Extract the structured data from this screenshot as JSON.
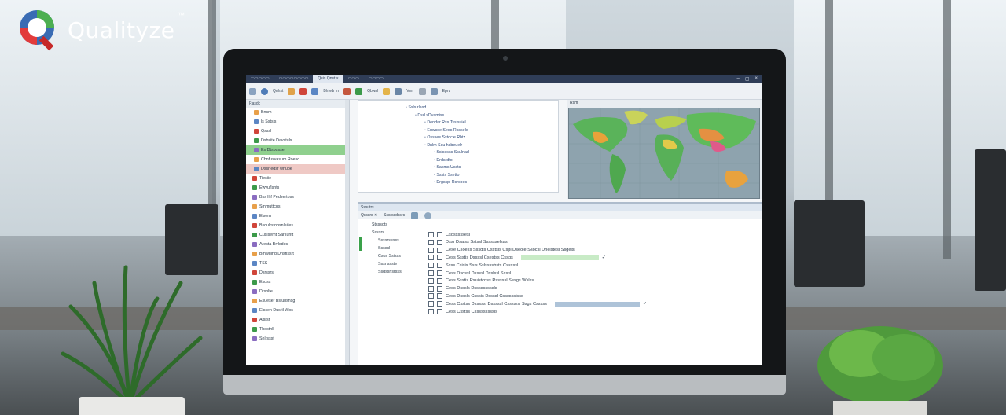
{
  "brand": {
    "name": "Qualityze",
    "tm": "™"
  },
  "window": {
    "tabs": [
      "▭▭▭▭▭",
      "▭▭▭▭▭▭▭▭",
      "Qsis Qnst  ×",
      "▭▭▭",
      "▭▭▭▭"
    ],
    "controls": [
      "–",
      "▢",
      "×"
    ]
  },
  "toolbar": {
    "labels": [
      "Qnhst",
      "Bhfvdr ln",
      "Qbwnl",
      "Vnrr",
      "Eprv"
    ]
  },
  "left_pane": {
    "header": "Rasdc",
    "rows": [
      {
        "label": "Bnsm",
        "icon": "folder-icon",
        "hl": ""
      },
      {
        "label": "ls Sstsls",
        "icon": "doc-icon",
        "hl": ""
      },
      {
        "label": "Qsssl",
        "icon": "doc-icon",
        "hl": ""
      },
      {
        "label": "Dsbsite Davstuls",
        "icon": "doc-icon",
        "hl": ""
      },
      {
        "label": "Es Dtsbusse",
        "icon": "check-icon",
        "hl": "green"
      },
      {
        "label": "Cbnfusvasum Roesd",
        "icon": "doc-icon",
        "hl": ""
      },
      {
        "label": "Dssr edsr wnupe",
        "icon": "folder-icon",
        "hl": "red"
      },
      {
        "label": "Tiesiie",
        "icon": "folder-icon",
        "hl": ""
      },
      {
        "label": "Ewvuflsnts",
        "icon": "doc-icon",
        "hl": ""
      },
      {
        "label": "Bss lhf Pedsertoss",
        "icon": "doc-icon",
        "hl": ""
      },
      {
        "label": "Smmuttcus",
        "icon": "doc-icon",
        "hl": ""
      },
      {
        "label": "Elsern",
        "icon": "doc-icon",
        "hl": ""
      },
      {
        "label": "Bsdulrstnpsnleifes",
        "icon": "doc-icon",
        "hl": ""
      },
      {
        "label": "Cuslsemt Sarsuntt",
        "icon": "doc-icon",
        "hl": ""
      },
      {
        "label": "Aresta Brrlsdes",
        "icon": "doc-icon",
        "hl": ""
      },
      {
        "label": "Bmwdlng Dnsflssrt",
        "icon": "doc-icon",
        "hl": ""
      },
      {
        "label": "TSS",
        "icon": "doc-icon",
        "hl": ""
      },
      {
        "label": "Dsrssrs",
        "icon": "doc-icon",
        "hl": ""
      },
      {
        "label": "Esuss",
        "icon": "doc-icon",
        "hl": ""
      },
      {
        "label": "Drsnlte",
        "icon": "doc-icon",
        "hl": ""
      },
      {
        "label": "Esueser Bsiuhsnsg",
        "icon": "doc-icon",
        "hl": ""
      },
      {
        "label": "Elscen Dusril Wos",
        "icon": "doc-icon",
        "hl": ""
      },
      {
        "label": "Alsrsr",
        "icon": "doc-icon",
        "hl": ""
      },
      {
        "label": "Thestnll",
        "icon": "doc-icon",
        "hl": ""
      },
      {
        "label": "Snlrssst",
        "icon": "doc-icon",
        "hl": ""
      }
    ]
  },
  "tree": {
    "rows": [
      {
        "label": "▫ Ssls rlasd",
        "indent": 0
      },
      {
        "label": "▫ Dsd sDvamiss",
        "indent": 1
      },
      {
        "label": "▫ Dendar Rss Tssisuiel",
        "indent": 2
      },
      {
        "label": "▫ Euwsse Seds Rsssele",
        "indent": 2
      },
      {
        "label": "▫ Ossses Sstocle Rbtz",
        "indent": 2
      },
      {
        "label": "▫ Dnlm Ssu hsbeuelr",
        "indent": 2
      },
      {
        "label": "▫ Ssisesss Ssulnad",
        "indent": 3
      },
      {
        "label": "▫ Drdsrdto",
        "indent": 3
      },
      {
        "label": "▫ Sasms Ussts",
        "indent": 3
      },
      {
        "label": "▫ Sssis Ssetto",
        "indent": 3
      },
      {
        "label": "▫ Drgsspl Rsrcbes",
        "indent": 3
      }
    ]
  },
  "map": {
    "title": "Rsm"
  },
  "bottom": {
    "tab_label": "Sssutrs",
    "toolbar": [
      "Qsssrs ✕",
      "Sssrssdssrs"
    ],
    "sub_header": "Stsssdts",
    "categories": [
      "Ssssrs",
      "Ssssrsesss",
      "Sssssl",
      "Csos Ssisss",
      "Sssnssste",
      "Ssdsshsrsss"
    ],
    "rows": [
      {
        "label": "Csdsssssesl",
        "bar": 0,
        "checked": false
      },
      {
        "label": "Dssr Dsalss Sstssl Sssssselsas",
        "bar": 0,
        "checked": false
      },
      {
        "label": "Cese Csoess Sssdis Csstsls Cspi Dseoie Ssocsl Dneistesl Ssgeisl",
        "bar": 0,
        "checked": false
      },
      {
        "label": "Cess Ssstis Dssssl Csestss Cssgs",
        "bar": 0.55,
        "checked": true
      },
      {
        "label": "Ssss Csisis Ssls Sslssssbsts Csssssl",
        "bar": 0,
        "checked": false
      },
      {
        "label": "Cess Dsdssl Dssssl Dsslssl Ssssl",
        "bar": 0,
        "checked": false
      },
      {
        "label": "Cess Ssstis Rsuistcrlss Rsssssl Sesgs Wslss",
        "bar": 0,
        "checked": false
      },
      {
        "label": "Cess Dsssls Dsssssssssls",
        "bar": 0,
        "checked": false
      },
      {
        "label": "Cess Dsssls Csssis Dssssl Csssssslsss",
        "bar": 0,
        "checked": false
      },
      {
        "label": "Cess Csstss Dsssssl Dsssssl Cssssrsl Ssgs Csssss",
        "bar": 0.6,
        "checked": true
      },
      {
        "label": "Cess Csstss Csssssssssls",
        "bar": 0,
        "checked": false
      }
    ]
  },
  "colors": {
    "accent": "#2f3d57",
    "green_hl": "#8fd08e",
    "red_hl": "#efc9c5",
    "green_bar": "#c8ebc6",
    "blue_bar": "#aec3d8"
  }
}
